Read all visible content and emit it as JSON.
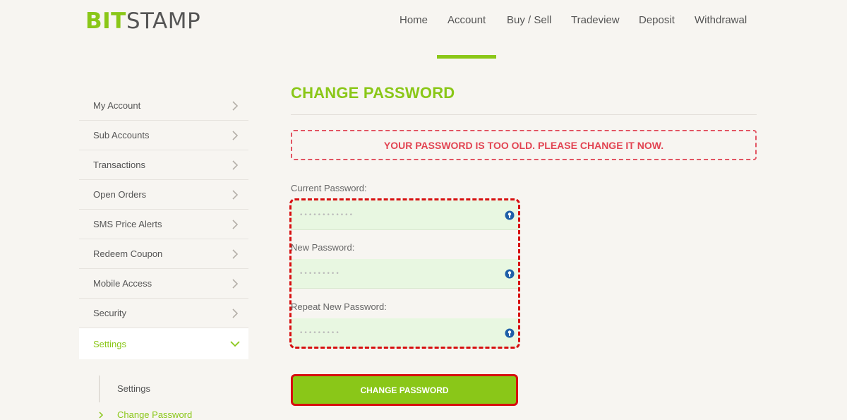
{
  "logo": {
    "part1": "BIT",
    "part2": "STAMP"
  },
  "nav": {
    "items": [
      {
        "label": "Home"
      },
      {
        "label": "Account"
      },
      {
        "label": "Buy / Sell"
      },
      {
        "label": "Tradeview"
      },
      {
        "label": "Deposit"
      },
      {
        "label": "Withdrawal"
      }
    ],
    "active": "Account"
  },
  "sidebar": {
    "items": [
      {
        "label": "My Account"
      },
      {
        "label": "Sub Accounts"
      },
      {
        "label": "Transactions"
      },
      {
        "label": "Open Orders"
      },
      {
        "label": "SMS Price Alerts"
      },
      {
        "label": "Redeem Coupon"
      },
      {
        "label": "Mobile Access"
      },
      {
        "label": "Security"
      },
      {
        "label": "Settings"
      }
    ],
    "sub_items": [
      {
        "label": "Settings"
      },
      {
        "label": "Change Password"
      }
    ]
  },
  "page": {
    "title": "CHANGE PASSWORD",
    "alert": "YOUR PASSWORD IS TOO OLD. PLEASE CHANGE IT NOW."
  },
  "form": {
    "current_label": "Current Password:",
    "current_value": "••••••••••••",
    "new_label": "New Password:",
    "new_value": "•••••••••",
    "repeat_label": "Repeat New Password:",
    "repeat_value": "•••••••••",
    "submit_label": "CHANGE PASSWORD"
  },
  "colors": {
    "brand_green": "#8ac718",
    "alert_red": "#e24452",
    "highlight_red": "#d70f0f",
    "field_bg": "#e8f7e1",
    "key_icon_blue": "#1f5fa8"
  },
  "icons": {
    "chevron": "chevron-right-icon",
    "chevron_open": "chevron-down-icon",
    "field_key": "key-icon"
  }
}
